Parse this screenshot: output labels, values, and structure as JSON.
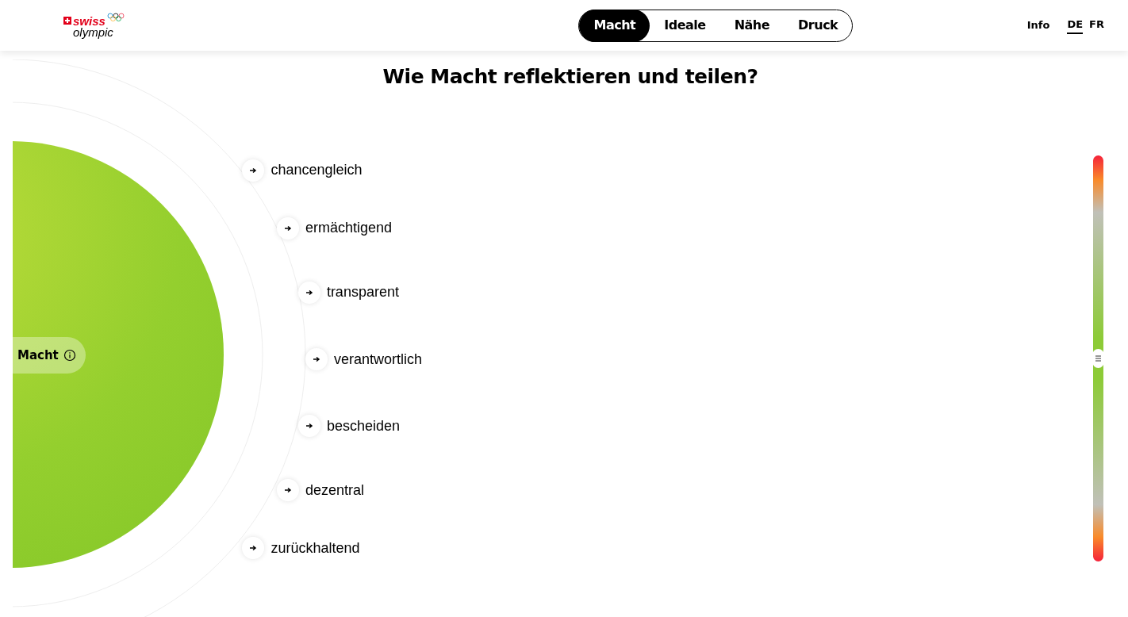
{
  "header": {
    "logo": {
      "line1": "swiss",
      "line2": "olympic"
    },
    "tabs": [
      {
        "label": "Macht",
        "selected": true
      },
      {
        "label": "Ideale",
        "selected": false
      },
      {
        "label": "Nähe",
        "selected": false
      },
      {
        "label": "Druck",
        "selected": false
      }
    ],
    "info": "Info",
    "languages": [
      {
        "label": "DE",
        "selected": true
      },
      {
        "label": "FR",
        "selected": false
      }
    ]
  },
  "title": "Wie Macht reflektieren und teilen?",
  "center": {
    "label": "Macht"
  },
  "items": [
    {
      "label": "chancengleich"
    },
    {
      "label": "ermächtigend"
    },
    {
      "label": "transparent"
    },
    {
      "label": "verantwortlich"
    },
    {
      "label": "bescheiden"
    },
    {
      "label": "dezentral"
    },
    {
      "label": "zurückhaltend"
    }
  ],
  "scale": {
    "level": 0.5
  }
}
